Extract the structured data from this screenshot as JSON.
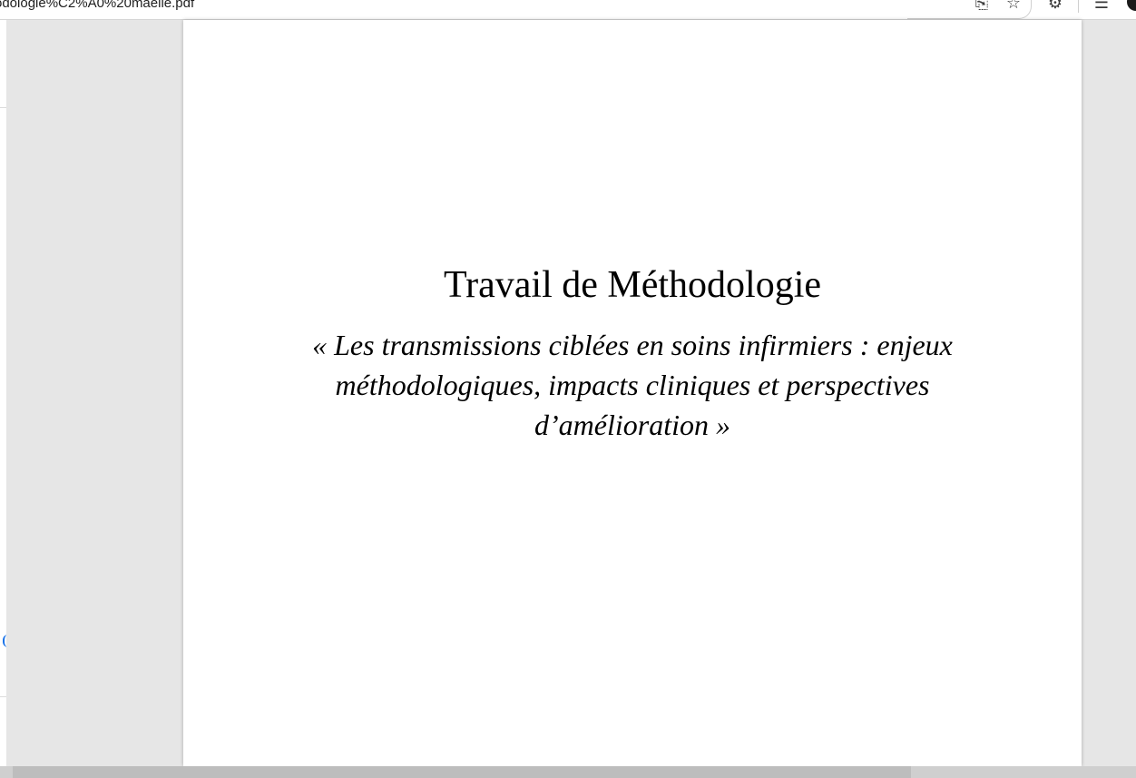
{
  "browser": {
    "url": "odologie%C2%A0%20maelle.pdf",
    "icons": {
      "read_aloud": "read-aloud-icon",
      "favorite": "star-icon",
      "extensions": "puzzle-icon",
      "favorites_list": "favorites-list-icon",
      "profile": "profile-icon"
    }
  },
  "document": {
    "title": "Travail de Méthodologie",
    "subtitle": "« Les transmissions ciblées en soins infirmiers : enjeux méthodologiques, impacts cliniques et perspectives d’amélioration »"
  },
  "colors": {
    "viewer_background": "#e6e6e6",
    "page_background": "#ffffff",
    "text": "#000000",
    "accent": "#1a73e8"
  }
}
